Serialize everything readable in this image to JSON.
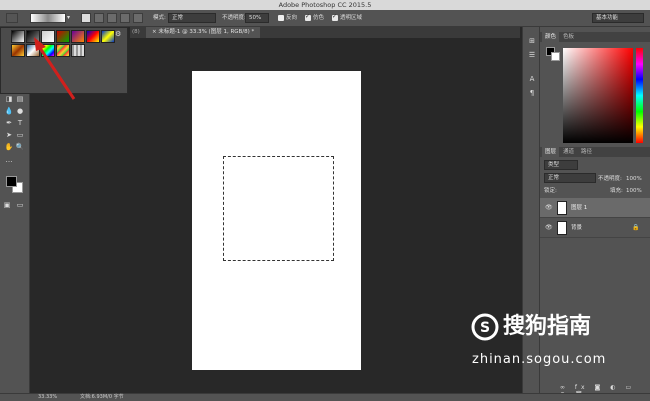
{
  "app": {
    "title": "Adobe Photoshop CC 2015.5"
  },
  "options": {
    "mode_label": "模式:",
    "mode_value": "正常",
    "opacity_label": "不透明度:",
    "opacity_value": "50%",
    "reverse_label": "反向",
    "dither_label": "仿色",
    "transparency_label": "透明区域",
    "workspace_value": "基本功能"
  },
  "tabs": {
    "hidden_prefix": "(8)",
    "active_doc": "未标题-1 @ 33.3% (图层 1, RGB/8) *"
  },
  "panels": {
    "color_tabs": [
      "颜色",
      "色板"
    ],
    "layer_tabs": [
      "图层",
      "通道",
      "路径"
    ],
    "filter_kind": "类型",
    "blend_mode": "正常",
    "opacity_label": "不透明度:",
    "opacity_value": "100%",
    "lock_label": "锁定:",
    "fill_label": "填充:",
    "fill_value": "100%",
    "layers": [
      {
        "name": "图层 1",
        "selected": true
      },
      {
        "name": "背景",
        "selected": false,
        "locked": true
      }
    ]
  },
  "status": {
    "zoom": "33.33%",
    "doc_info": "文档:6.93M/0 字节"
  },
  "watermark": {
    "brand": "搜狗指南",
    "url": "zhinan.sogou.com"
  },
  "gradient_presets": [
    "black-white",
    "black-transparent",
    "white-transparent",
    "red-green",
    "violet-orange",
    "blue-red-yellow",
    "blue-yellow-blue",
    "copper",
    "chrome",
    "spectrum",
    "transparent-rainbow",
    "transparent-stripes"
  ],
  "colors": {
    "foreground": "#000000",
    "background": "#ffffff",
    "accent_arrow": "#d0201d"
  }
}
